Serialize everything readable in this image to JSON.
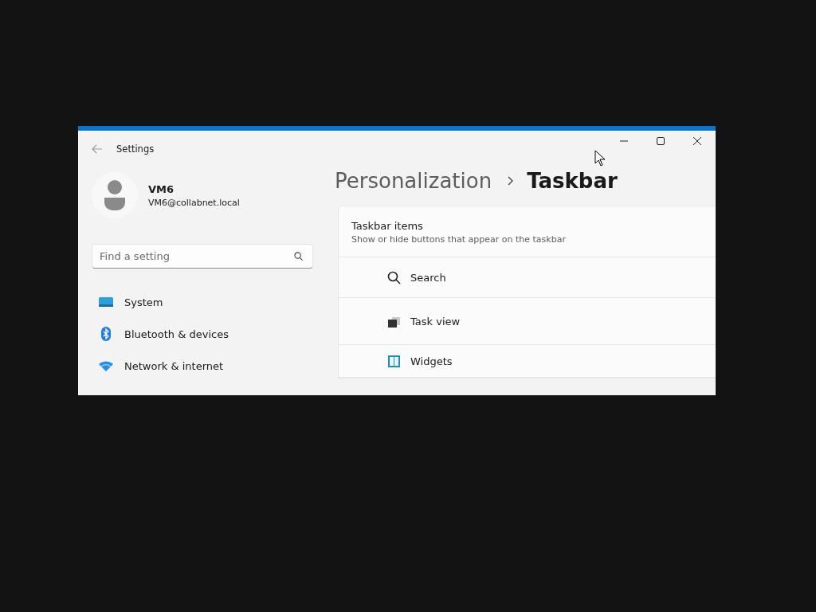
{
  "window": {
    "title": "Settings"
  },
  "profile": {
    "name": "VM6",
    "email": "VM6@collabnet.local"
  },
  "search": {
    "placeholder": "Find a setting"
  },
  "nav": [
    {
      "label": "System",
      "kind": "system"
    },
    {
      "label": "Bluetooth & devices",
      "kind": "bluetooth"
    },
    {
      "label": "Network & internet",
      "kind": "network"
    }
  ],
  "breadcrumb": [
    "Personalization",
    "Taskbar"
  ],
  "card": {
    "title": "Taskbar items",
    "subtitle": "Show or hide buttons that appear on the taskbar",
    "items": [
      {
        "label": "Search",
        "kind": "search"
      },
      {
        "label": "Task view",
        "kind": "taskview"
      },
      {
        "label": "Widgets",
        "kind": "widgets"
      }
    ]
  }
}
